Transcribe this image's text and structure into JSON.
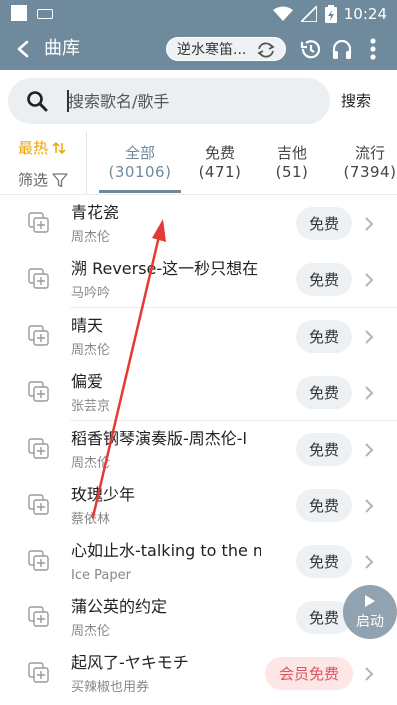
{
  "status_bar": {
    "time": "10:24"
  },
  "header": {
    "title": "曲库",
    "now_playing": "逆水寒笛..."
  },
  "search": {
    "placeholder": "搜索歌名/歌手",
    "button_label": "搜索"
  },
  "sort": {
    "label": "最热"
  },
  "filter": {
    "label": "筛选"
  },
  "tabs": [
    {
      "label": "全部",
      "count": "(30106)",
      "active": true
    },
    {
      "label": "免费",
      "count": "(471)"
    },
    {
      "label": "吉他",
      "count": "(51)"
    },
    {
      "label": "流行",
      "count": "(7394)"
    }
  ],
  "songs": [
    {
      "title": "青花瓷",
      "artist": "周杰伦",
      "badge": "免费"
    },
    {
      "title": "溯 Reverse-这一秒只想在",
      "artist": "马吟吟",
      "badge": "免费"
    },
    {
      "title": "晴天",
      "artist": "周杰伦",
      "badge": "免费"
    },
    {
      "title": "偏爱",
      "artist": "张芸京",
      "badge": "免费"
    },
    {
      "title": "稻香钢琴演奏版-周杰伦-l",
      "artist": "周杰伦",
      "badge": "免费"
    },
    {
      "title": "玫瑰少年",
      "artist": "蔡依林",
      "badge": "免费"
    },
    {
      "title": "心如止水-talking to the m",
      "artist": "Ice Paper",
      "badge": "免费"
    },
    {
      "title": "蒲公英的约定",
      "artist": "周杰伦",
      "badge": "免费"
    },
    {
      "title": "起风了-ヤキモチ",
      "artist": "买辣椒也用券",
      "badge": "会员免费"
    }
  ],
  "fab": {
    "label": "启动"
  },
  "colors": {
    "primary": "#6e8a9c",
    "accent_hot": "#f0a500",
    "vip_text": "#e0525a",
    "vip_bg": "#fde6e6",
    "annotation": "#e53935"
  }
}
